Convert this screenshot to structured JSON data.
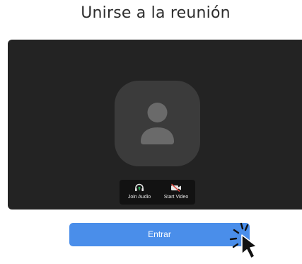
{
  "page": {
    "title": "Unirse a la reunión"
  },
  "controls": {
    "join_audio_label": "Join Audio",
    "start_video_label": "Start Video"
  },
  "actions": {
    "join_label": "Entrar"
  },
  "colors": {
    "accent": "#4a8eea",
    "preview_bg": "#232323",
    "avatar_bg": "#3b3b3b",
    "audio_icon": "#37c167"
  },
  "icons": [
    "avatar-placeholder-icon",
    "headphones-icon",
    "video-off-icon",
    "pointer-cursor-icon"
  ]
}
